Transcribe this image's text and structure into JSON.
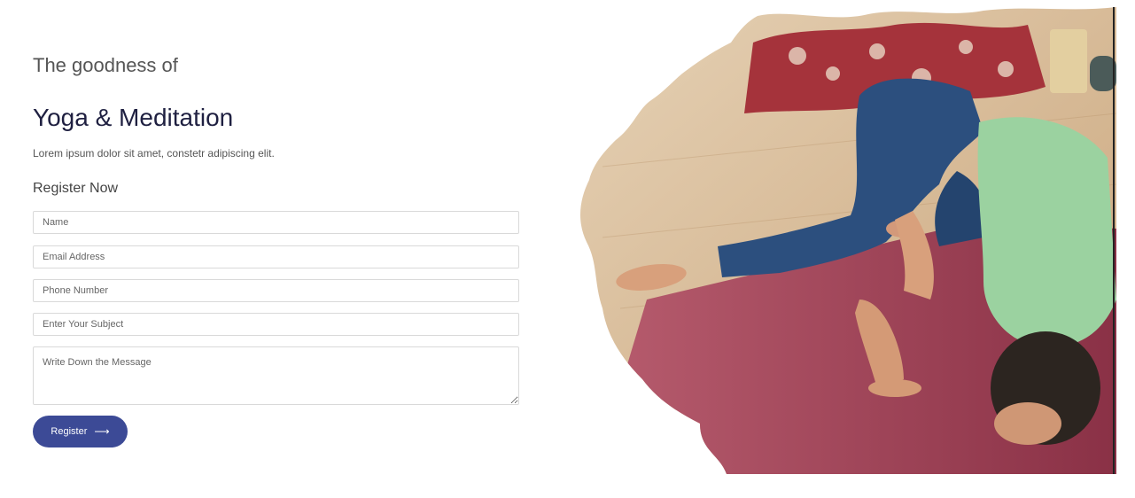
{
  "hero": {
    "subtitle": "The goodness of",
    "title": "Yoga & Meditation",
    "lead": "Lorem ipsum dolor sit amet, constetr adipiscing elit."
  },
  "form": {
    "title": "Register Now",
    "name_placeholder": "Name",
    "email_placeholder": "Email Address",
    "phone_placeholder": "Phone Number",
    "subject_placeholder": "Enter Your Subject",
    "message_placeholder": "Write Down the Message",
    "submit_label": "Register",
    "submit_icon": "arrow-right-icon"
  },
  "image": {
    "subject": "yoga-pose-photo"
  },
  "colors": {
    "accent": "#3c4a96",
    "title": "#1f2041",
    "text": "#555555",
    "mat": "#9b3e52",
    "shirt": "#9bd2a0",
    "jeans": "#2c4f7e",
    "floor": "#d8b78e"
  }
}
